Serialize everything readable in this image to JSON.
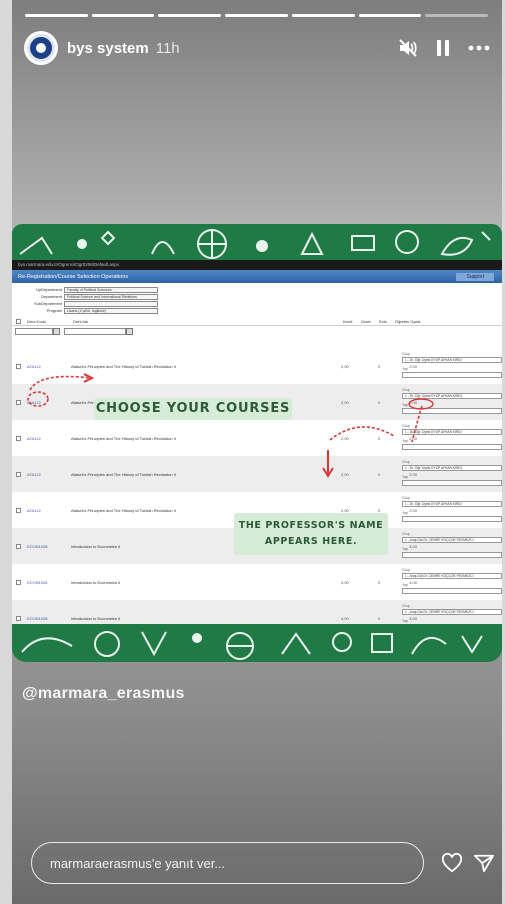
{
  "story": {
    "progress": {
      "total": 7,
      "completed": 6
    },
    "header": {
      "username": "bys system",
      "time": "11h",
      "icons": [
        "muted-icon",
        "pause-icon",
        "more-icon"
      ]
    },
    "screenshot": {
      "url": "bys.marmara.edu.tr/Ogrenci/Ogr0206/Default.aspx",
      "title": "Re-Registration/Course Selection Operations",
      "support_label": "Support",
      "filters": [
        {
          "label": "UpDepartment",
          "value": "Faculty of Political Sciences"
        },
        {
          "label": "Department",
          "value": "Political Science and International Relations"
        },
        {
          "label": "SubDepartment",
          "value": ""
        },
        {
          "label": "Program",
          "value": "Lisans (4 yıllık, İngilizce)"
        }
      ],
      "columns": [
        "Ders Kodu",
        "Ders Adı",
        "Kredi",
        "Ücret",
        "Ects",
        "Öğretim Üyesi"
      ],
      "rows": [
        {
          "code": "ATA122",
          "name": "Ataturk's Principles and The History of Turkish Revolution II",
          "kredi": "2,00",
          "ucret": "0",
          "ects": "2,00",
          "grup": "Grup",
          "yap": "Yap",
          "prof": "1 - Dr. Öğr. Üyesi EYÜP AYHAN KIRDI"
        },
        {
          "code": "ATA122",
          "name": "Ataturk's Principles and The History of Turkish Revolution II",
          "kredi": "2,00",
          "ucret": "0",
          "ects": "2,00",
          "grup": "Grup",
          "yap": "Yap",
          "prof": "1 - Dr. Öğr. Üyesi EYÜP AYHAN KIRDI"
        },
        {
          "code": "ATA122",
          "name": "Ataturk's Principles and The History of Turkish Revolution II",
          "kredi": "2,00",
          "ucret": "0",
          "ects": "2,00",
          "grup": "Grup",
          "yap": "Yap",
          "prof": "1 - Dr. Öğr. Üyesi EYÜP AYHAN KIRDI"
        },
        {
          "code": "ATA122",
          "name": "Ataturk's Principles and The History of Turkish Revolution II",
          "kredi": "2,00",
          "ucret": "0",
          "ects": "2,00",
          "grup": "Grup",
          "yap": "Yap",
          "prof": "1 - Dr. Öğr. Üyesi EYÜP AYHAN KIRDI"
        },
        {
          "code": "ATA122",
          "name": "Ataturk's Principles and The History of Turkish Revolution II",
          "kredi": "2,00",
          "ucret": "0",
          "ects": "2,00",
          "grup": "Grup",
          "yap": "Yap",
          "prof": "1 - Dr. Öğr. Üyesi EYÜP AYHAN KIRDI"
        },
        {
          "code": "ECON1008",
          "name": "Introduction to Economics II",
          "kredi": "4,00",
          "ucret": "0",
          "ects": "4,00",
          "grup": "Grup",
          "yap": "Yap",
          "prof": "1 - Araş.Gör.Dr. CEMRE KOÇÇOK PEXMEZCİ"
        },
        {
          "code": "ECON1008",
          "name": "Introduction to Economics II",
          "kredi": "4,00",
          "ucret": "0",
          "ects": "4,00",
          "grup": "Grup",
          "yap": "Yap",
          "prof": "1 - Araş.Gör.Dr. CEMRE KOÇÇOK PEXMEZCİ"
        },
        {
          "code": "ECON1008",
          "name": "Introduction to Economics II",
          "kredi": "4,00",
          "ucret": "0",
          "ects": "4,00",
          "grup": "Grup",
          "yap": "Yap",
          "prof": "1 - Araş.Gör.Dr. CEMRE KOÇÇOK PEXMEZCİ"
        }
      ],
      "annotations": {
        "choose": "CHOOSE YOUR COURSES",
        "professor_line1": "THE PROFESSOR'S NAME",
        "professor_line2": "APPEARS HERE."
      }
    },
    "handle": "@marmara_erasmus",
    "reply": {
      "placeholder": "marmaraerasmus'e yanıt ver..."
    },
    "colors": {
      "card_green": "#1f7a46",
      "badge_bg": "#d6ecd6",
      "badge_text": "#2d5a36",
      "annotation_red": "#d93636",
      "sis_blue": "#2d63a6"
    }
  }
}
